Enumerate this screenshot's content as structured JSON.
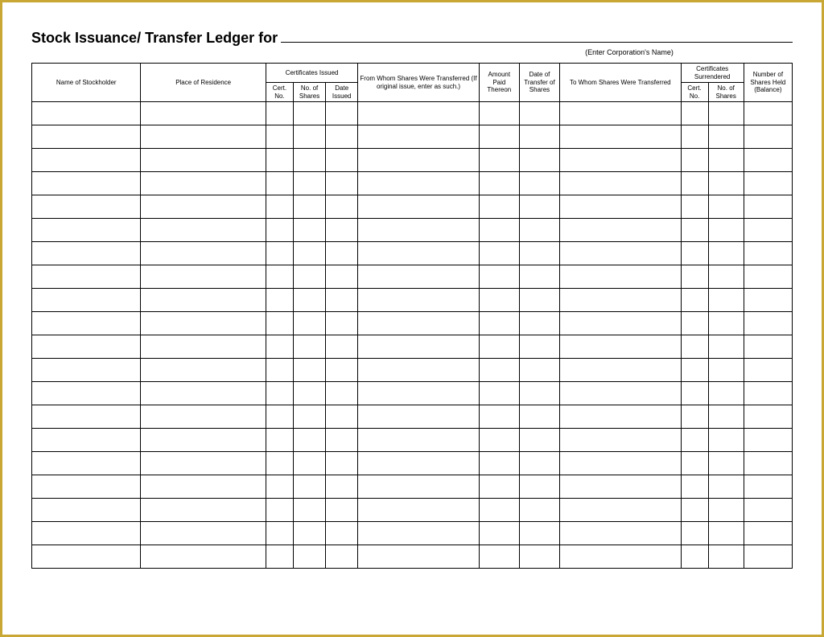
{
  "title": "Stock Issuance/ Transfer Ledger for",
  "corp_hint": "(Enter Corporation's Name)",
  "headers": {
    "stockholder": "Name of Stockholder",
    "residence": "Place of Residence",
    "cert_issued": "Certificates Issued",
    "cert_no": "Cert. No.",
    "no_shares": "No. of Shares",
    "date_issued": "Date Issued",
    "from_whom": "From Whom Shares Were Transferred (If original issue, enter as such.)",
    "amount_paid": "Amount Paid Thereon",
    "date_transfer": "Date of Transfer of Shares",
    "to_whom": "To Whom Shares Were Transferred",
    "cert_surrendered": "Certificates Surrendered",
    "balance": "Number of Shares Held (Balance)"
  },
  "row_count": 20
}
